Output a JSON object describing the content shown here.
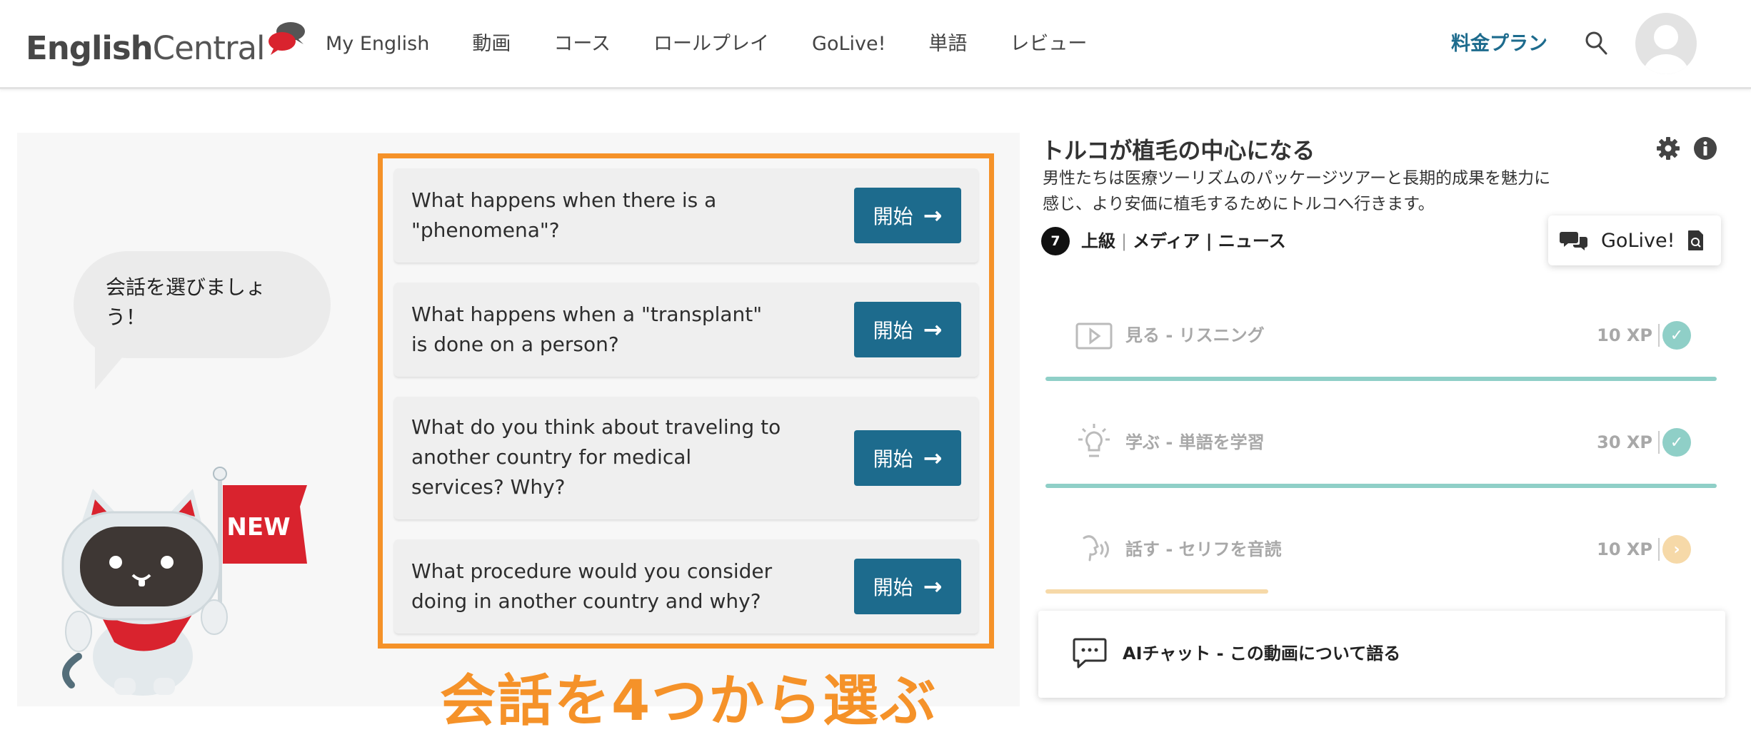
{
  "header": {
    "logo_bold": "English",
    "logo_light": "Central",
    "nav": [
      "My English",
      "動画",
      "コース",
      "ロールプレイ",
      "GoLive!",
      "単語",
      "レビュー"
    ],
    "pricing": "料金プラン"
  },
  "left": {
    "bubble_text": "会話を選びましょう！",
    "badge": "NEW",
    "questions": [
      "What happens when there is a \"phenomena\"?",
      "What happens when a \"transplant\" is done on a person?",
      "What do you think about traveling to another country for medical services? Why?",
      "What procedure would you consider doing in another country and why?"
    ],
    "start_label": "開始",
    "caption": "会話を4つから選ぶ"
  },
  "lesson": {
    "title": "トルコが植毛の中心になる",
    "description": "男性たちは医療ツーリズムのパッケージツアーと長期的成果を魅力に感じ、より安価に植毛するためにトルコへ行きます。",
    "level_number": "7",
    "level_label": "上級",
    "category": "メディア | ニュース",
    "golive_label": "GoLive!",
    "steps": [
      {
        "label": "見る - リスニング",
        "xp": "10 XP",
        "status": "done",
        "progress": 1.0,
        "color": "#8fcfc7"
      },
      {
        "label": "学ぶ - 単語を学習",
        "xp": "30 XP",
        "status": "done",
        "progress": 1.0,
        "color": "#8fcfc7"
      },
      {
        "label": "話す - セリフを音読",
        "xp": "10 XP",
        "status": "next",
        "progress": 0.33,
        "color": "#f6d9a8"
      }
    ],
    "ai_chat_label": "AIチャット - この動画について語る"
  },
  "colors": {
    "brand": "#1d6b8d",
    "accent_orange": "#f59229",
    "teal_done": "#8fcfc7",
    "peach_next": "#f6d9a8",
    "mascot_red": "#d9232e"
  }
}
